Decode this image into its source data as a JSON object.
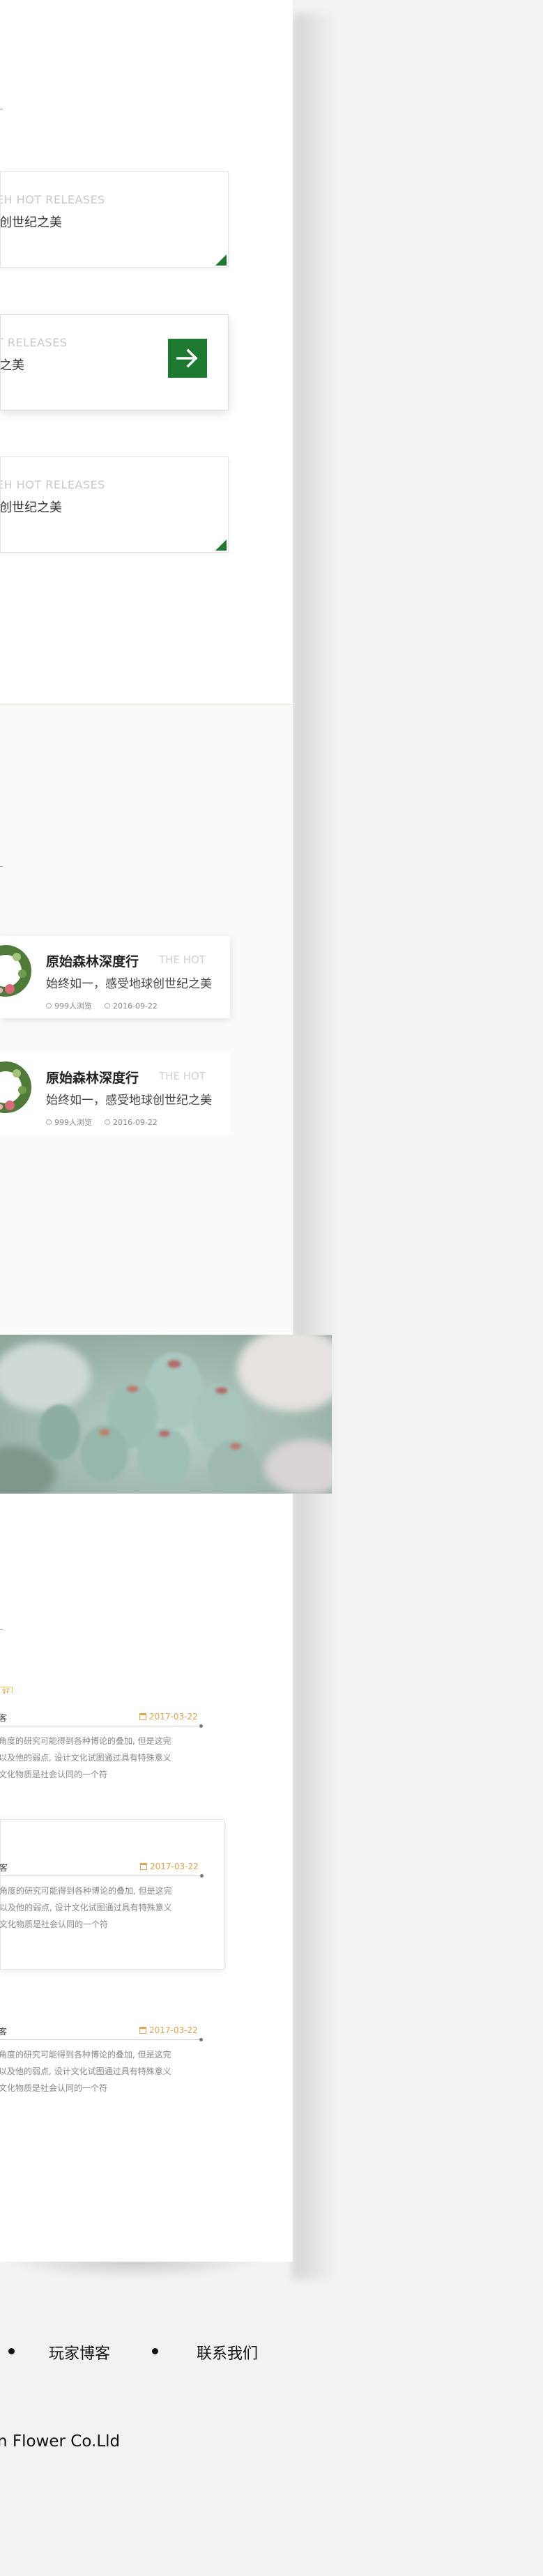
{
  "releases": {
    "cards": [
      {
        "en": "EH HOT RELEASES",
        "cn": "创世纪之美",
        "style": "corner"
      },
      {
        "en": "T RELEASES",
        "cn": "之美",
        "style": "arrow"
      },
      {
        "en": "EH HOT RELEASES",
        "cn": "创世纪之美",
        "style": "corner"
      }
    ],
    "accent_color": "#1f7a31",
    "corner_icon": "triangle-corner",
    "arrow_icon": "arrow-right-icon"
  },
  "hot": {
    "items": [
      {
        "title": "原始森林深度行",
        "tag": "THE HOT",
        "subtitle": "始终如一，感受地球创世纪之美",
        "views": "999人浏览",
        "date": "2016-09-22"
      },
      {
        "title": "原始森林深度行",
        "tag": "THE HOT",
        "subtitle": "始终如一，感受地球创世纪之美",
        "views": "999人浏览",
        "date": "2016-09-22"
      }
    ]
  },
  "banner": {
    "image_icon": "succulent-photo"
  },
  "blog": {
    "tag": "好",
    "tag_color": "#e0a24a",
    "entries": [
      {
        "label": "客",
        "date": "2017-03-22",
        "text": "角度的研究可能得到各种博论的叠加, 但是这完\n以及他的弱点, 设计文化试图通过具有特殊意义\n文化物质是社会认同的一个符"
      },
      {
        "label": "客",
        "date": "2017-03-22",
        "text": "角度的研究可能得到各种博论的叠加, 但是这完\n以及他的弱点, 设计文化试图通过具有特殊意义\n文化物质是社会认同的一个符"
      },
      {
        "label": "客",
        "date": "2017-03-22",
        "text": "角度的研究可能得到各种博论的叠加, 但是这完\n以及他的弱点, 设计文化试图通过具有特殊意义\n文化物质是社会认同的一个符"
      }
    ]
  },
  "footer": {
    "nav": [
      "玩家博客",
      "联系我们"
    ],
    "copyright": "n Flower Co.Lld"
  }
}
